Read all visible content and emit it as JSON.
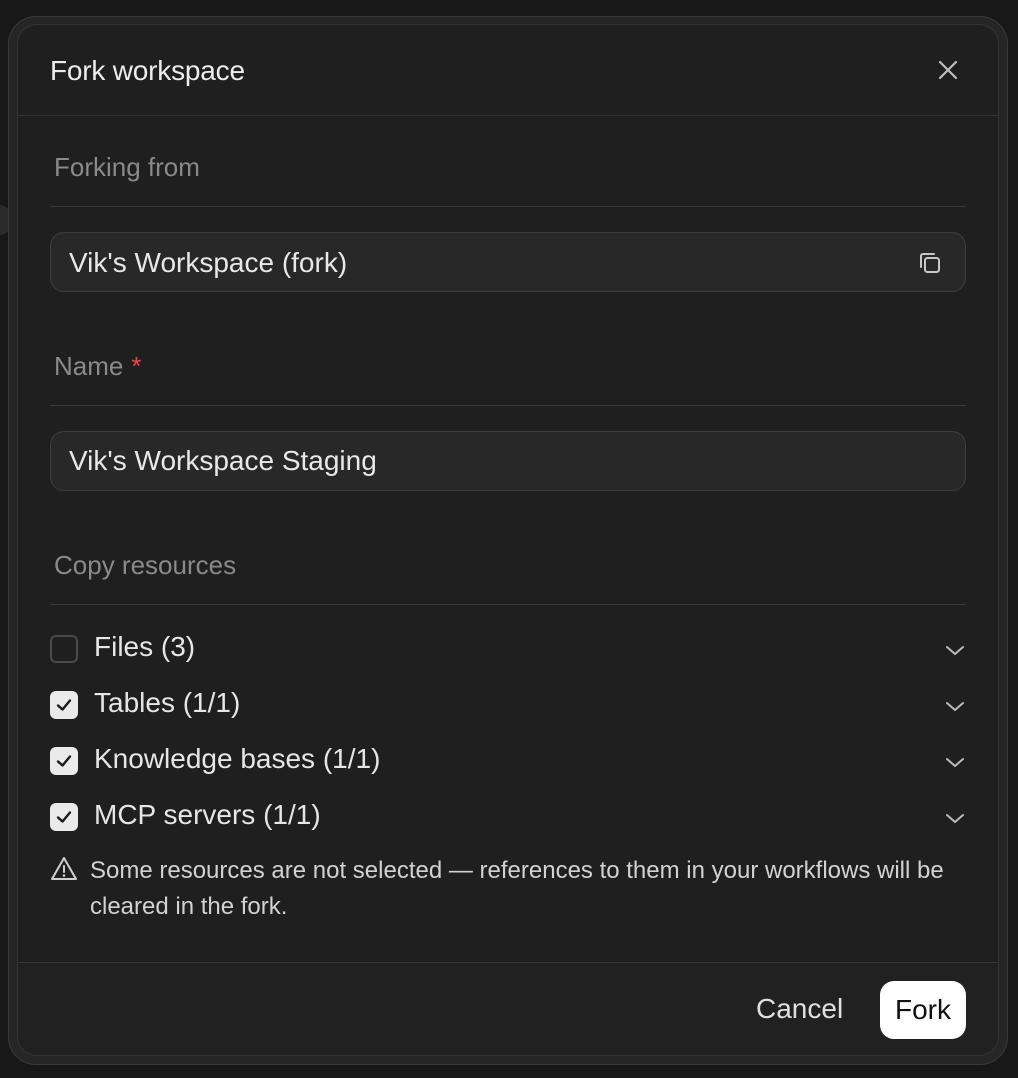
{
  "dialog": {
    "title": "Fork workspace"
  },
  "forking_from": {
    "label": "Forking from",
    "value": "Vik's Workspace (fork)"
  },
  "name": {
    "label": "Name",
    "required_mark": "*",
    "value": "Vik's Workspace Staging"
  },
  "copy_resources": {
    "label": "Copy resources",
    "items": [
      {
        "label": "Files (3)",
        "checked": false
      },
      {
        "label": "Tables (1/1)",
        "checked": true
      },
      {
        "label": "Knowledge bases (1/1)",
        "checked": true
      },
      {
        "label": "MCP servers (1/1)",
        "checked": true
      }
    ]
  },
  "warning": {
    "text": "Some resources are not selected — references to them in your workflows will be cleared in the fork."
  },
  "footer": {
    "cancel_label": "Cancel",
    "fork_label": "Fork"
  },
  "colors": {
    "background": "#181818",
    "modal": "#1f1f1f",
    "required": "#e5484d",
    "primary_button": "#ffffff"
  },
  "icons": [
    "close-icon",
    "copy-icon",
    "check-icon",
    "chevron-down-icon",
    "warning-icon"
  ]
}
